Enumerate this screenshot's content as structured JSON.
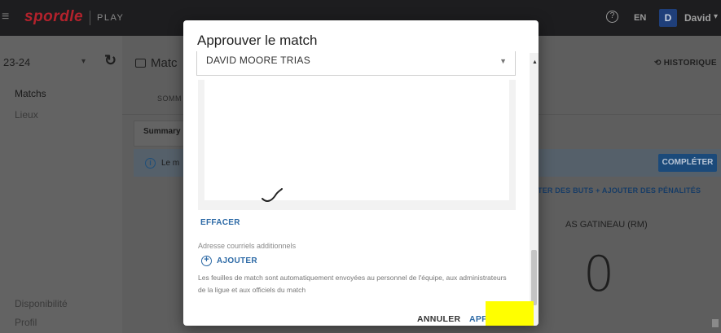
{
  "app": {
    "logo": "spordle",
    "product": "PLAY",
    "language": "EN",
    "avatar_initial": "D",
    "user_name": "David",
    "icons": [
      "menu-icon",
      "help-icon",
      "chevron-down-icon",
      "refresh-icon",
      "history-icon",
      "info-icon",
      "plus-icon",
      "add-circle-icon"
    ]
  },
  "sidebar": {
    "season": "23-24",
    "items": [
      {
        "label": "Matchs"
      },
      {
        "label": "Lieux"
      },
      {
        "label": "Disponibilité"
      },
      {
        "label": "Profil"
      }
    ]
  },
  "main": {
    "title": "Matc",
    "history_label": "HISTORIQUE",
    "tab_label": "SOMM",
    "summary_label": "Summary",
    "banner_text": "Le m",
    "complete_label": "COMPLÉTER",
    "actions_text": "TER DES BUTS  +  AJOUTER DES PÉNALITÉS",
    "team_name": "AS GATINEAU (RM)",
    "score": "0"
  },
  "modal": {
    "title": "Approuver le match",
    "selected_official": "DAVID MOORE TRIAS",
    "clear_label": "EFFACER",
    "extra_emails_label": "Adresse courriels additionnels",
    "add_label": "AJOUTER",
    "note": "Les feuilles de match sont automatiquement envoyées au personnel de l'équipe, aux administrateurs de la ligue et aux officiels du match",
    "cancel_label": "ANNULER",
    "approve_label": "APP"
  },
  "colors": {
    "brand_red": "#b3222c",
    "accent_blue": "#2d6aa6",
    "redaction": "#ffff00"
  }
}
